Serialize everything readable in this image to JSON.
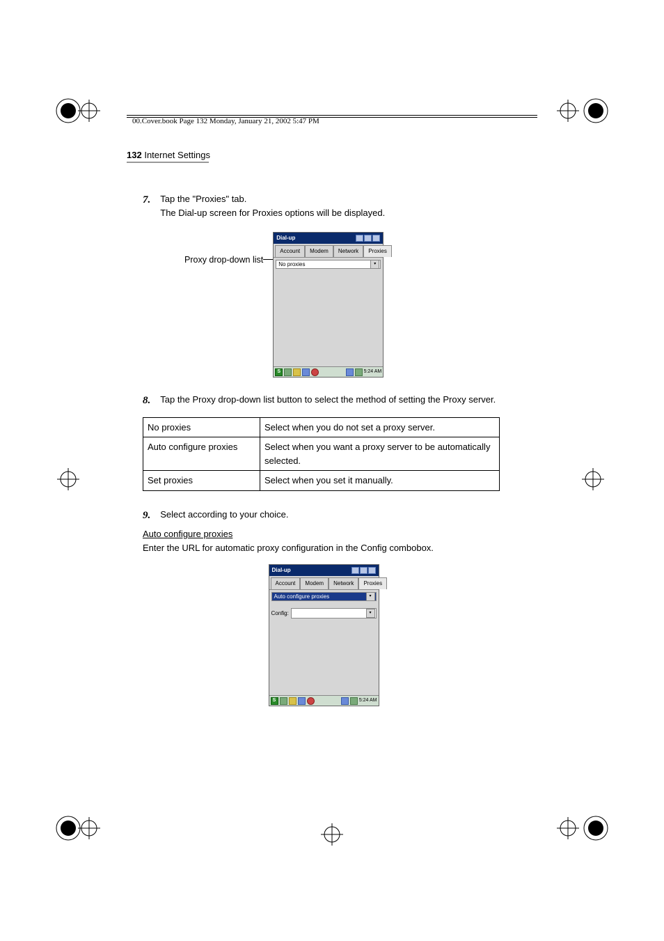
{
  "header": {
    "breadcrumb": "00.Cover.book  Page 132  Monday, January 21, 2002  5:47 PM",
    "page_num": "132",
    "section": "Internet Settings"
  },
  "steps": {
    "s7": {
      "num": "7.",
      "line1": "Tap the \"Proxies\" tab.",
      "line2": "The Dial-up screen for Proxies options will be displayed."
    },
    "s8": {
      "num": "8.",
      "line1": "Tap the Proxy drop-down list button to select the method of setting the Proxy server."
    },
    "s9": {
      "num": "9.",
      "line1": "Select according to your choice."
    }
  },
  "callout1": "Proxy drop-down list",
  "table": {
    "rows": [
      {
        "opt": "No proxies",
        "desc": "Select when you do not set a proxy server."
      },
      {
        "opt": "Auto configure proxies",
        "desc": "Select when you want a proxy server to be automatically selected."
      },
      {
        "opt": "Set proxies",
        "desc": "Select when you set it manually."
      }
    ]
  },
  "auto_section": {
    "heading": "Auto configure proxies",
    "body": "Enter the URL for automatic proxy configuration in the Config combobox."
  },
  "device": {
    "title": "Dial-up",
    "tabs": {
      "account": "Account",
      "modem": "Modem",
      "network": "Network",
      "proxies": "Proxies"
    },
    "dd_noproxies": "No proxies",
    "dd_autoconf": "Auto configure proxies",
    "config_label": "Config:",
    "clock": "5:24 AM",
    "start": "S"
  }
}
